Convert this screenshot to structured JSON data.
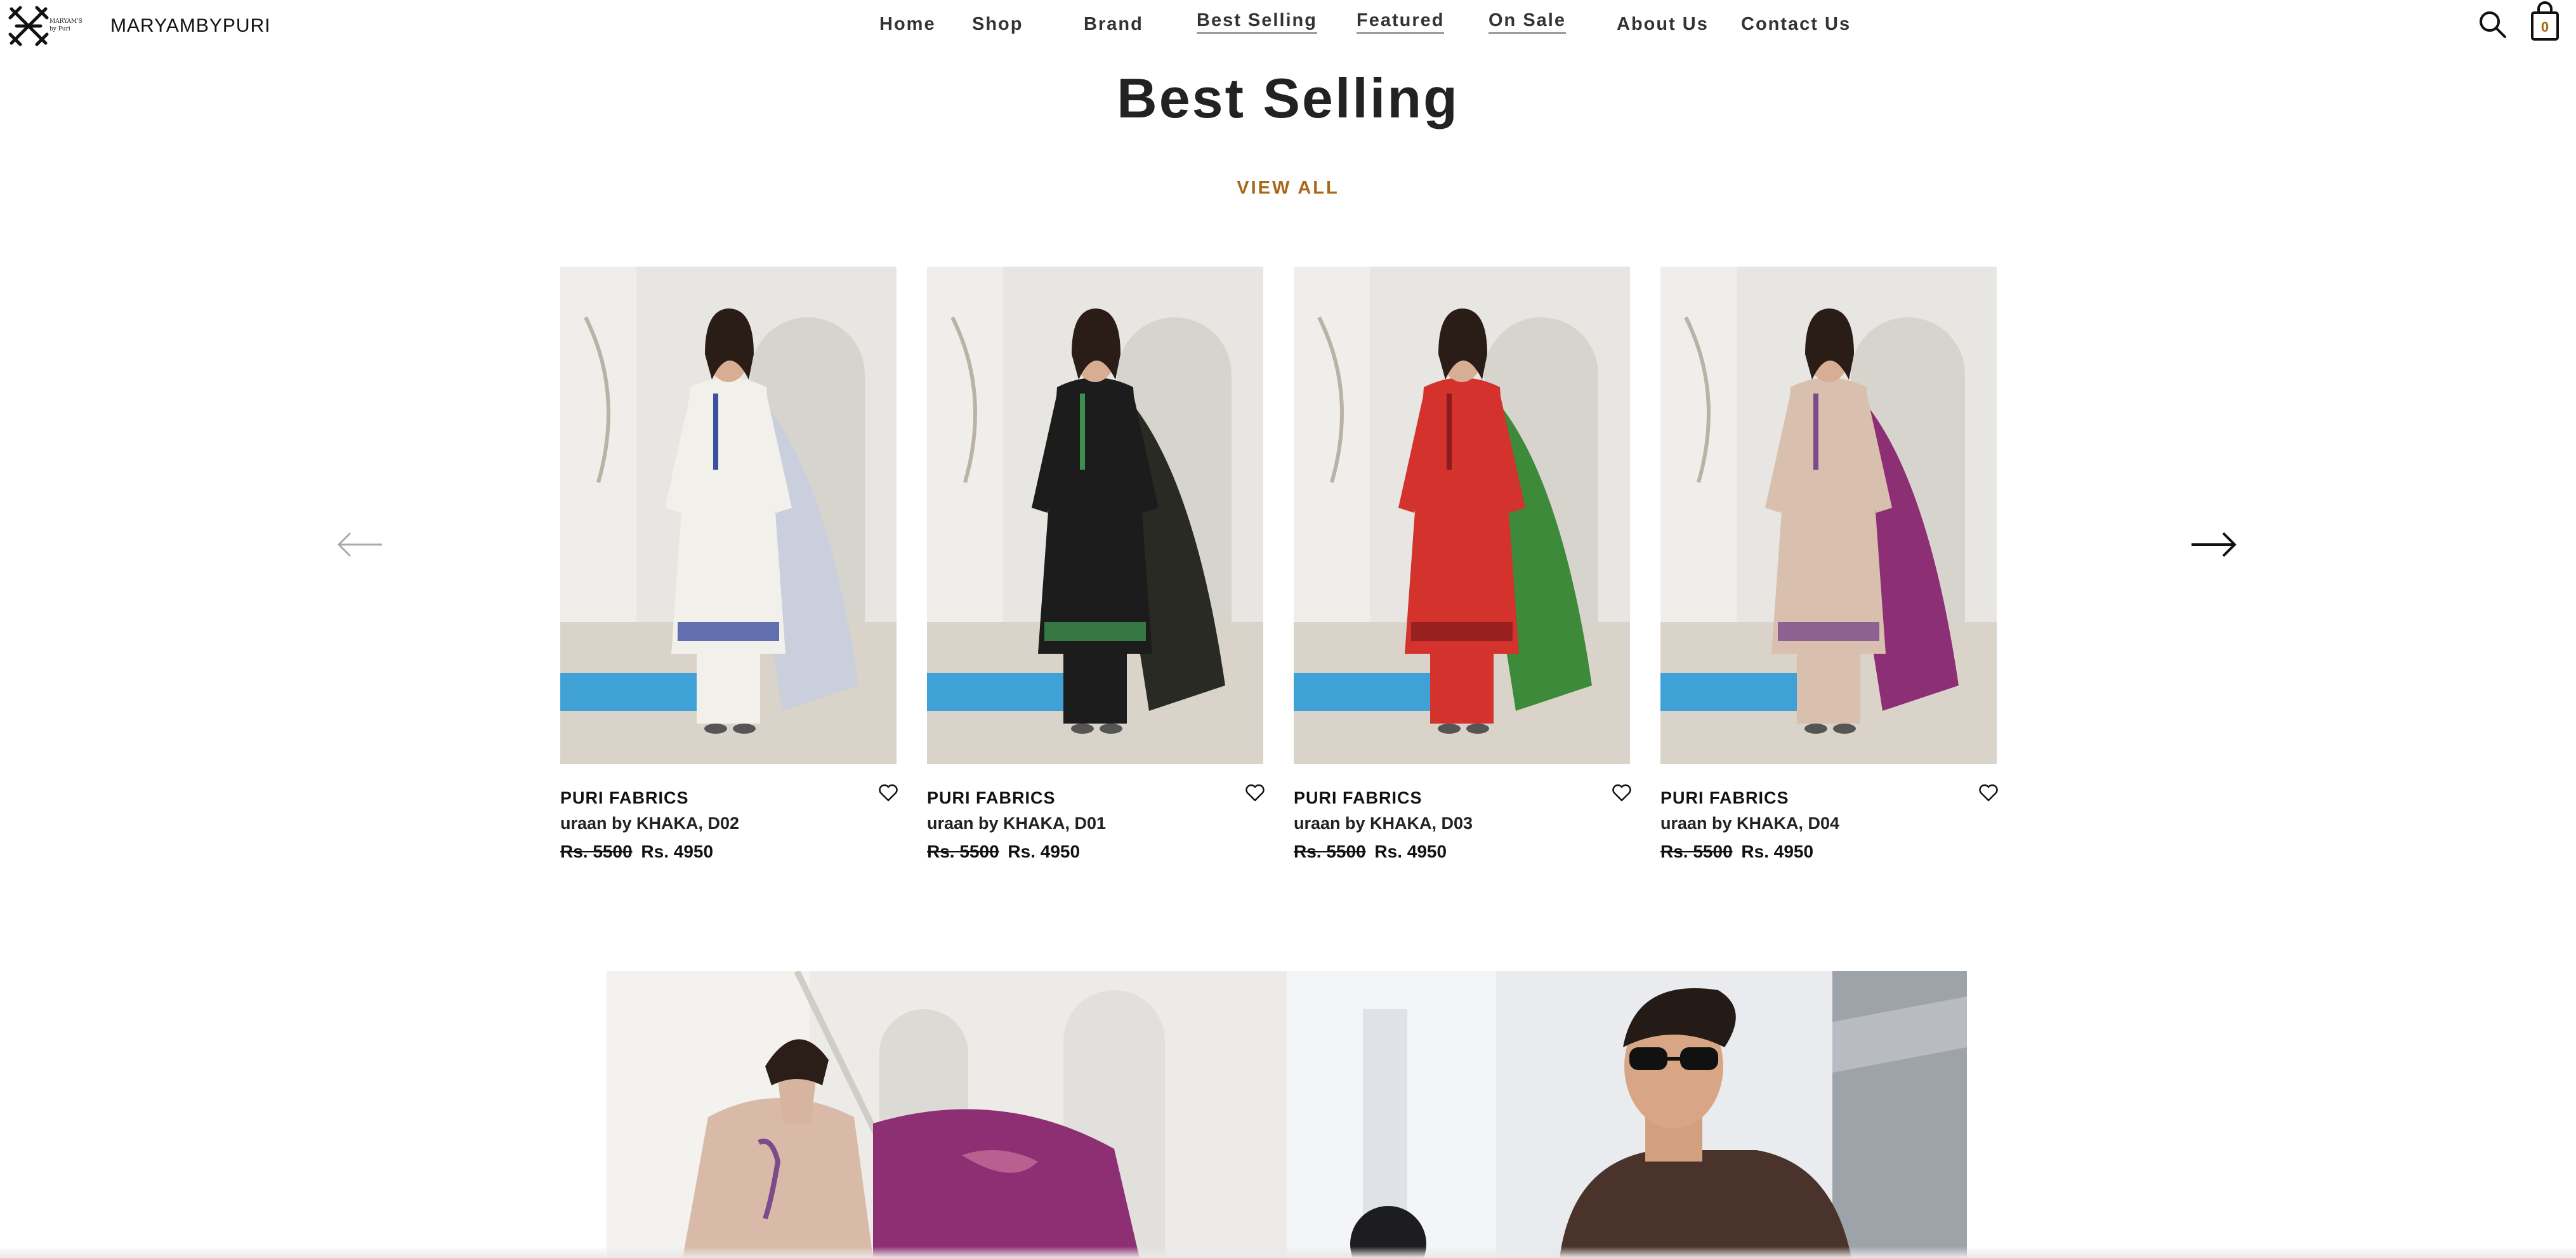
{
  "header": {
    "logo_small_text": "MARYAM'S by Puri",
    "brand_name": "MARYAMBYPURI",
    "nav": [
      "Home",
      "Shop",
      "Brand",
      "Best Selling",
      "Featured",
      "On Sale",
      "About Us",
      "Contact Us"
    ],
    "cart_count": "0",
    "icons": {
      "search": "search-icon",
      "cart": "shopping-bag-icon"
    }
  },
  "section": {
    "title": "Best Selling",
    "view_all": "VIEW ALL"
  },
  "products": [
    {
      "brand": "PURI FABRICS",
      "name": "uraan by KHAKA, D02",
      "old_price": "Rs. 5500",
      "price": "Rs. 4950",
      "dress_color": "#f2f0ea",
      "accent_color": "#3d4fa0",
      "dupatta_color": "#c9cfdc"
    },
    {
      "brand": "PURI FABRICS",
      "name": "uraan by KHAKA, D01",
      "old_price": "Rs. 5500",
      "price": "Rs. 4950",
      "dress_color": "#1c1c1c",
      "accent_color": "#3e8f4d",
      "dupatta_color": "#2a2a24"
    },
    {
      "brand": "PURI FABRICS",
      "name": "uraan by KHAKA, D03",
      "old_price": "Rs. 5500",
      "price": "Rs. 4950",
      "dress_color": "#d3322d",
      "accent_color": "#8a1c1c",
      "dupatta_color": "#3d8a3a"
    },
    {
      "brand": "PURI FABRICS",
      "name": "uraan by KHAKA, D04",
      "old_price": "Rs. 5500",
      "price": "Rs. 4950",
      "dress_color": "#d8bfae",
      "accent_color": "#7b4a8a",
      "dupatta_color": "#8c2f74"
    }
  ],
  "colors": {
    "accent": "#a8671a",
    "text": "#111111",
    "background": "#ffffff"
  }
}
